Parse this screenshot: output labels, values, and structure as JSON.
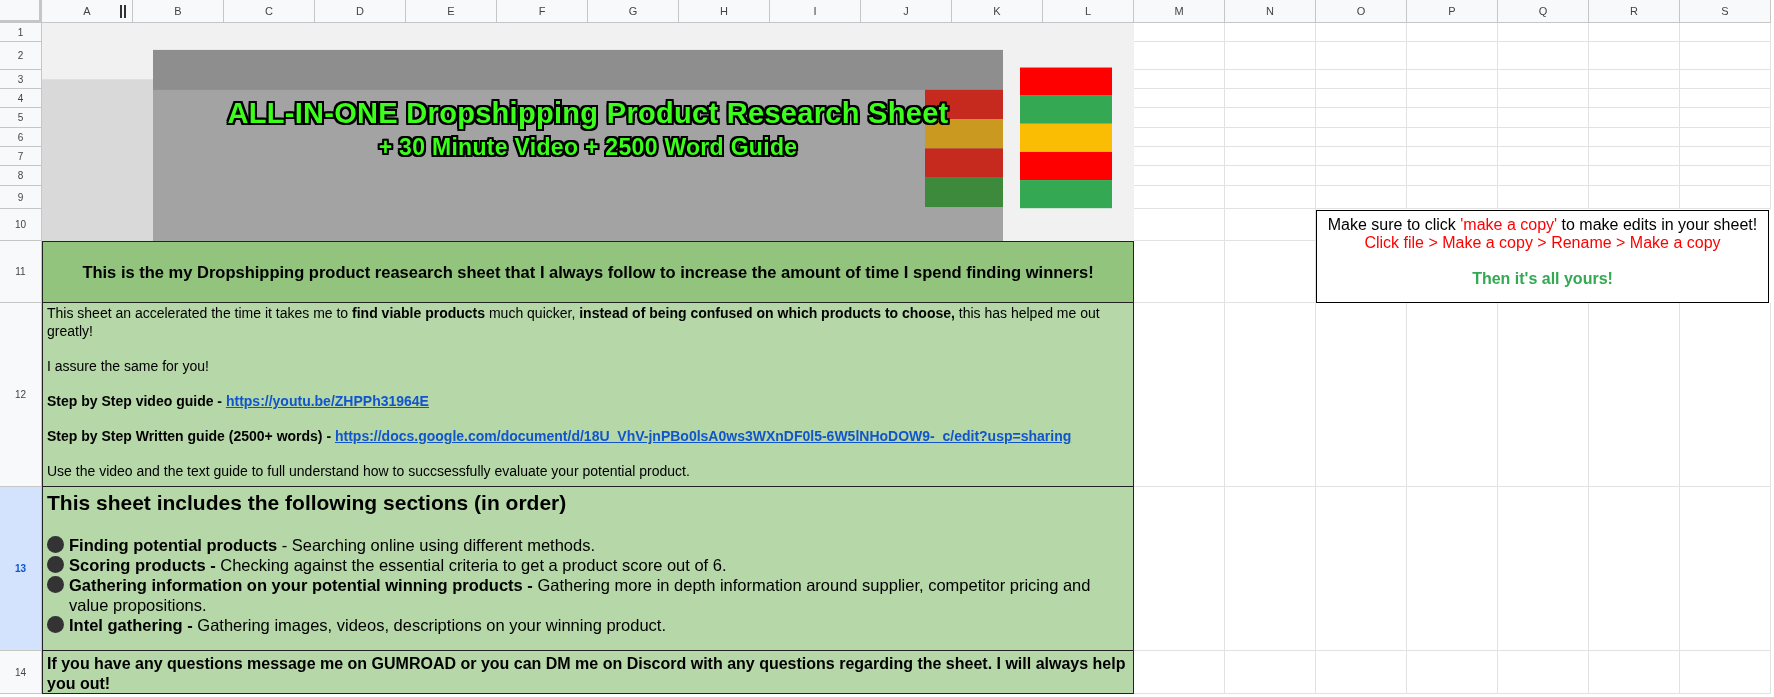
{
  "column_headers": [
    "A",
    "B",
    "C",
    "D",
    "E",
    "F",
    "G",
    "H",
    "I",
    "J",
    "K",
    "L",
    "M",
    "N",
    "O",
    "P",
    "Q",
    "R",
    "S"
  ],
  "row_headers": [
    {
      "label": "1",
      "selected": false
    },
    {
      "label": "2",
      "selected": false
    },
    {
      "label": "3",
      "selected": false
    },
    {
      "label": "4",
      "selected": false
    },
    {
      "label": "5",
      "selected": false
    },
    {
      "label": "6",
      "selected": false
    },
    {
      "label": "7",
      "selected": false
    },
    {
      "label": "8",
      "selected": false
    },
    {
      "label": "9",
      "selected": false
    },
    {
      "label": "10",
      "selected": false
    },
    {
      "label": "11",
      "selected": false
    },
    {
      "label": "12",
      "selected": false
    },
    {
      "label": "13",
      "selected": true
    },
    {
      "label": "14",
      "selected": false
    }
  ],
  "banner": {
    "kind": "picture",
    "title": "ALL-IN-ONE Dropshipping Product Research Sheet",
    "subtitle": "+ 30 Minute Video + 2500 Word Guide"
  },
  "intro_heading": "This is the my Dropshipping product reasearch sheet that I always follow to increase the amount of time I spend finding winners!",
  "intro": [
    {
      "kind": "text",
      "text": "This sheet an accelerated the time it takes me to **find viable products** much quicker, **instead of being confused on which products to choose,** this has helped me out greatly!"
    },
    {
      "kind": "text",
      "text": "I assure the same for you!"
    },
    {
      "kind": "link",
      "label": "Step by Step video guide - ",
      "url": "https://youtu.be/ZHPPh31964E"
    },
    {
      "kind": "link",
      "label": "Step by Step Written guide (2500+ words) - ",
      "url": "https://docs.google.com/document/d/18U_VhV-jnPBo0lsA0ws3WXnDF0l5-6W5lNHoDOW9-_c/edit?usp=sharing"
    },
    {
      "kind": "text",
      "text": "Use the video and the text guide to full understand how to succsessfully evaluate your potential product."
    }
  ],
  "sections": {
    "heading": "This sheet includes the following sections (in order)",
    "items": [
      "**Finding potential products** - Searching online using different methods.",
      "**Scoring products -** Checking against the essential criteria to get a product score out of 6.",
      "**Gathering information on your potential winning products -** Gathering more in depth information around supplier, competitor pricing and value propositions.",
      "**Intel gathering -** Gathering images, videos, descriptions on your winning product."
    ]
  },
  "footer": "If you have any questions message me on GUMROAD or you can DM me on Discord with any questions regarding the sheet. I will always help you out!",
  "note": {
    "lines": [
      {
        "bold": false,
        "parts": [
          {
            "text": "Make sure to click ",
            "color": "#000000"
          },
          {
            "text": "'make a copy'",
            "color": "#ff0000"
          },
          {
            "text": " to make edits in your sheet!",
            "color": "#000000"
          }
        ]
      },
      {
        "bold": false,
        "parts": [
          {
            "text": "Click file > Make a copy > Rename > Make a copy",
            "color": "#ff0000"
          }
        ]
      },
      {
        "bold": true,
        "parts": [
          {
            "text": "Then it's all yours!",
            "color": "#34a853"
          }
        ]
      }
    ]
  }
}
